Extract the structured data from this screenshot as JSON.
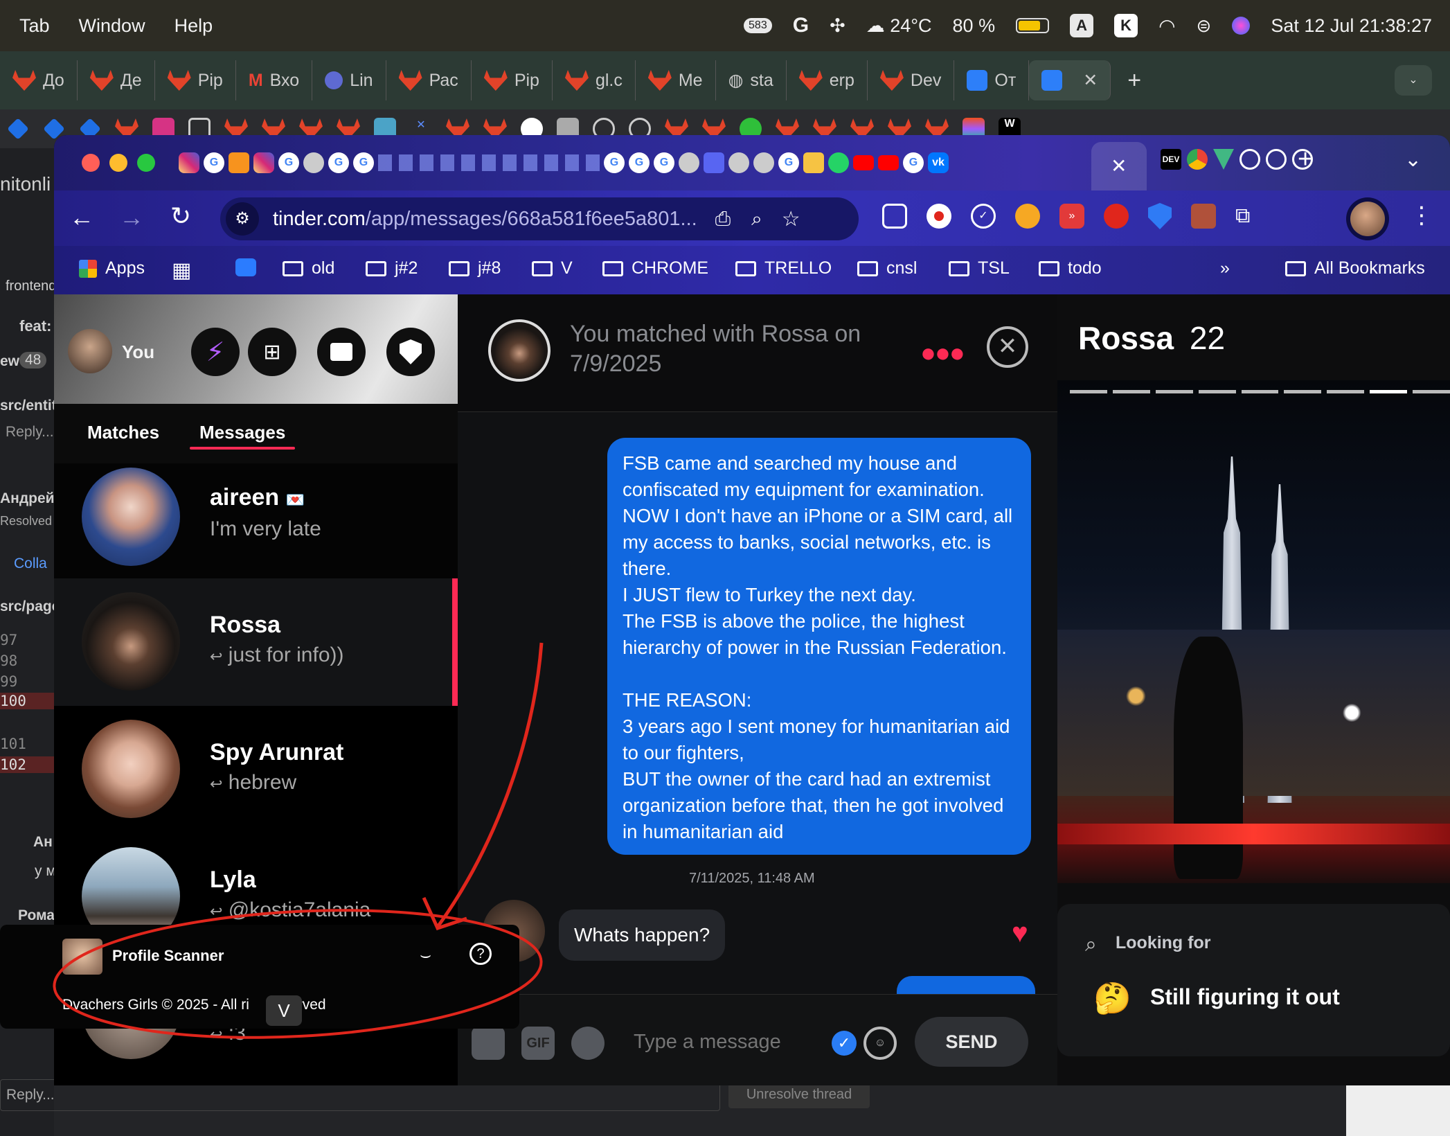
{
  "menubar": {
    "items": [
      "Tab",
      "Window",
      "Help"
    ],
    "badge": "583",
    "weather": "24°C",
    "battery": "80 %",
    "datetime": "Sat 12 Jul  21:38:27"
  },
  "back_window": {
    "tabs": [
      "Дo",
      "Де",
      "Pip",
      "Вхо",
      "Lin",
      "Рас",
      "Pip",
      "gl.c",
      "Me",
      "sta",
      "erp",
      "Dev",
      "От"
    ],
    "left_text": [
      "nitonli",
      "frontend",
      "feat:",
      "ew",
      "48",
      "src/entit",
      "Reply...",
      "Андрей",
      "Resolved",
      "Colla",
      "src/page",
      "97",
      "98",
      "99",
      "100",
      "101",
      "102",
      "Ан",
      "у м",
      "Рома"
    ],
    "reply": "Reply...",
    "unresolve": "Unresolve thread"
  },
  "browser": {
    "url_host": "tinder.com",
    "url_path": "/app/messages/668a581f6ee5a801...",
    "bookmarks": [
      "Apps",
      "old",
      "j#2",
      "j#8",
      "V",
      "CHROME",
      "TRELLO",
      "cnsl",
      "TSL",
      "todo"
    ],
    "all_bookmarks": "All Bookmarks"
  },
  "sidebar": {
    "you_label": "You",
    "tabs": [
      "Matches",
      "Messages"
    ],
    "conversations": [
      {
        "name": "aireen",
        "message": "I'm very late",
        "emoji": "💌",
        "reply": false
      },
      {
        "name": "Rossa",
        "message": "just for info))",
        "reply": true,
        "selected": true
      },
      {
        "name": "Spy Arunrat",
        "message": "hebrew",
        "reply": true
      },
      {
        "name": "Lyla",
        "message": "@kostia7alania",
        "reply": true
      },
      {
        "name": "",
        "message": ":3",
        "reply": true
      }
    ]
  },
  "chat": {
    "header": "You matched with Rossa on 7/9/2025",
    "sent_message": "FSB came and searched my house and confiscated my equipment for examination. NOW I don't have an iPhone or a SIM card, all my access to banks, social networks, etc. is there.\nI JUST flew to Turkey the next day.\nThe FSB is above the police, the highest hierarchy of power in the Russian Federation.\n\nTHE REASON:\n3 years ago I sent money for humanitarian aid to our fighters,\nBUT the owner of the card had an extremist organization before that, then he got involved in humanitarian aid",
    "timestamp": "7/11/2025, 11:48 AM",
    "received_message": "Whats happen?",
    "input_placeholder": "Type a message",
    "send": "SEND",
    "gif": "GIF"
  },
  "profile": {
    "name": "Rossa",
    "age": "22",
    "looking_for_label": "Looking for",
    "looking_for_value": "Still figuring it out",
    "looking_for_emoji": "🤔"
  },
  "overlay": {
    "title": "Profile Scanner",
    "footer": "Dvachers Girls © 2025 - All ri",
    "footer_end": "eserved",
    "toggle": "V"
  },
  "colors": {
    "accent": "#fd2a54",
    "bubble": "#1168e0",
    "annotation": "#e0261c"
  }
}
